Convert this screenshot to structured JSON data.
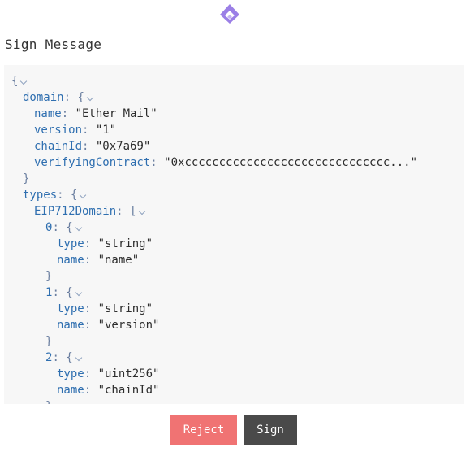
{
  "header": {
    "logo_icon": "app-logo-icon",
    "title": "Sign Message"
  },
  "message_tree": [
    {
      "indent": 0,
      "key": "",
      "open": "{",
      "collapsible": true
    },
    {
      "indent": 1,
      "key": "domain",
      "open": "{",
      "collapsible": true
    },
    {
      "indent": 2,
      "key": "name",
      "value": "\"Ether Mail\""
    },
    {
      "indent": 2,
      "key": "version",
      "value": "\"1\""
    },
    {
      "indent": 2,
      "key": "chainId",
      "value": "\"0x7a69\""
    },
    {
      "indent": 2,
      "key": "verifyingContract",
      "value": "\"0xcccccccccccccccccccccccccccccc...\""
    },
    {
      "indent": 1,
      "close": "}"
    },
    {
      "indent": 1,
      "key": "types",
      "open": "{",
      "collapsible": true
    },
    {
      "indent": 2,
      "key": "EIP712Domain",
      "open": "[",
      "collapsible": true
    },
    {
      "indent": 3,
      "key": "0",
      "open": "{",
      "collapsible": true
    },
    {
      "indent": 4,
      "key": "type",
      "value": "\"string\""
    },
    {
      "indent": 4,
      "key": "name",
      "value": "\"name\""
    },
    {
      "indent": 3,
      "close": "}"
    },
    {
      "indent": 3,
      "key": "1",
      "open": "{",
      "collapsible": true
    },
    {
      "indent": 4,
      "key": "type",
      "value": "\"string\""
    },
    {
      "indent": 4,
      "key": "name",
      "value": "\"version\""
    },
    {
      "indent": 3,
      "close": "}"
    },
    {
      "indent": 3,
      "key": "2",
      "open": "{",
      "collapsible": true
    },
    {
      "indent": 4,
      "key": "type",
      "value": "\"uint256\""
    },
    {
      "indent": 4,
      "key": "name",
      "value": "\"chainId\""
    },
    {
      "indent": 3,
      "close": "}"
    }
  ],
  "actions": {
    "reject_label": "Reject",
    "sign_label": "Sign"
  },
  "colors": {
    "reject": "#f07373",
    "sign": "#4a4a4a",
    "logo": "#9b7fe6",
    "json_key": "#2f6fb0"
  }
}
